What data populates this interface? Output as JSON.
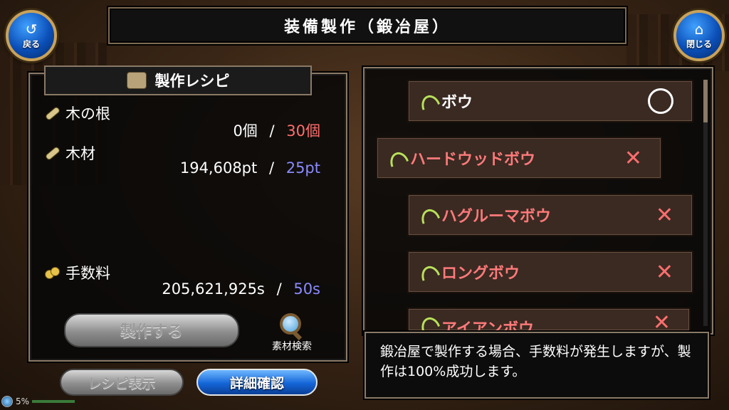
{
  "header": {
    "title": "装備製作（鍛冶屋）",
    "back_label": "戻る",
    "back_icon": "return-arrow-icon",
    "close_label": "閉じる",
    "close_icon": "home-icon"
  },
  "recipe": {
    "title": "製作レシピ",
    "icon": "recipe-box-icon",
    "materials": [
      {
        "name": "木の根",
        "have": "0個",
        "need": "30個",
        "icon": "wood-root-icon"
      },
      {
        "name": "木材",
        "have": "194,608pt",
        "need": "25pt",
        "icon": "lumber-icon"
      }
    ],
    "fee": {
      "label": "手数料",
      "have": "205,621,925s",
      "need": "50s",
      "icon": "coins-icon"
    },
    "separator": "/",
    "craft_button": "製作する",
    "search_label": "素材検索"
  },
  "bottom_buttons": {
    "recipe_view": "レシピ表示",
    "details": "詳細確認"
  },
  "item_list": [
    {
      "name": "ボウ",
      "status": "circle"
    },
    {
      "name": "ハードウッドボウ",
      "status": "cross"
    },
    {
      "name": "ハグルーマボウ",
      "status": "cross"
    },
    {
      "name": "ロングボウ",
      "status": "cross"
    },
    {
      "name": "アイアンボウ",
      "status": "cross"
    }
  ],
  "message": "鍛冶屋で製作する場合、手数料が発生しますが、製作は100%成功します。",
  "status_bar": {
    "battery": "5%"
  },
  "colors": {
    "insufficient": "#ff6e6e",
    "sufficient": "#8a8aff",
    "accent_blue": "#1465d8",
    "frame": "#8a7a66"
  }
}
